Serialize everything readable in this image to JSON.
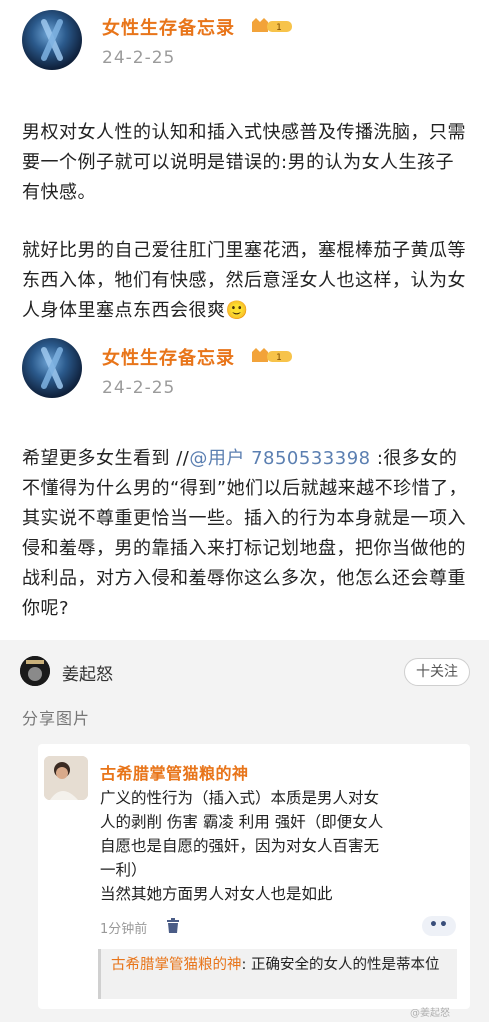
{
  "posts": [
    {
      "author": "女性生存备忘录",
      "level_badge": "1",
      "date": "24-2-25",
      "paragraphs": [
        "男权对女人性的认知和插入式快感普及传播洗脑，只需要一个例子就可以说明是错误的:男的认为女人生孩子有快感。",
        "就好比男的自己爱往肛门里塞花洒，塞棍棒茄子黄瓜等东西入体，牠们有快感，然后意淫女人也这样，认为女人身体里塞点东西会很爽🙂"
      ]
    },
    {
      "author": "女性生存备忘录",
      "level_badge": "1",
      "date": "24-2-25",
      "text_prefix": "希望更多女生看到 //",
      "mention": "@用户 7850533398",
      "text_suffix": " :很多女的不懂得为什么男的“得到”她们以后就越来越不珍惜了，其实说不尊重更恰当一些。插入的行为本身就是一项入侵和羞辱，男的靠插入来打标记划地盘，把你当做他的战利品，对方入侵和羞辱你这么多次，他怎么还会尊重你呢?"
    }
  ],
  "share": {
    "author": "姜起怒",
    "follow_label": "十关注",
    "label": "分享图片"
  },
  "comment": {
    "author": "古希腊掌管猫粮的神",
    "text_lines": [
      "广义的性行为（插入式）本质是男人对女",
      "人的剥削 伤害 霸凌 利用 强奸（即便女人",
      "自愿也是自愿的强奸，因为对女人百害无",
      "一利）",
      "当然其她方面男人对女人也是如此"
    ],
    "time": "1分钟前",
    "more_label": "••",
    "reply_author": "古希腊掌管猫粮的神",
    "reply_text": ": 正确安全的女人的性是蒂本位"
  },
  "watermark": "@姜起怒",
  "colors": {
    "accent": "#e8751a",
    "mention": "#5b7fb1"
  }
}
